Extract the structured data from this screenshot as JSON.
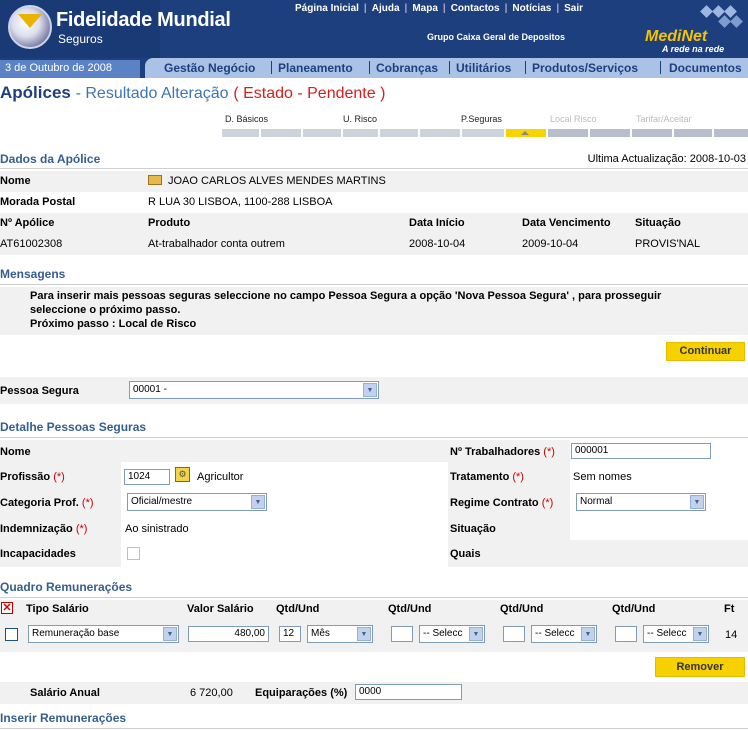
{
  "brand": {
    "name": "Fidelidade Mundial",
    "sub": "Seguros"
  },
  "top_links": [
    "Página Inicial",
    "Ajuda",
    "Mapa",
    "Contactos",
    "Notícias",
    "Sair"
  ],
  "group_text": "Grupo Caixa Geral de Depositos",
  "medinet": {
    "name": "MediNet",
    "tagline": "A rede na rede"
  },
  "date": "3 de Outubro de 2008",
  "nav": [
    "Gestão Negócio",
    "Planeamento",
    "Cobranças",
    "Utilitários",
    "Produtos/Serviços",
    "Documentos"
  ],
  "title": {
    "main": "Apólices",
    "sub": "- Resultado Alteração",
    "state": "( Estado - Pendente )"
  },
  "steps": [
    "D. Básicos",
    "U. Risco",
    "P.Seguras",
    "Local Risco",
    "Tarifar/Aceitar"
  ],
  "policy": {
    "section": "Dados da Apólice",
    "last_update": "Ultima Actualização: 2008-10-03",
    "name_label": "Nome",
    "name_value": "JOAO CARLOS ALVES MENDES MARTINS",
    "address_label": "Morada Postal",
    "address_value": "R LUA 30 LISBOA, 1100-288 LISBOA",
    "headers": [
      "Nº Apólice",
      "Produto",
      "Data Início",
      "Data Vencimento",
      "Situação"
    ],
    "row": [
      "AT61002308",
      "At-trabalhador conta outrem",
      "2008-10-04",
      "2009-10-04",
      "PROVIS'NAL"
    ]
  },
  "messages": {
    "section": "Mensagens",
    "line1": "Para inserir mais pessoas seguras seleccione no campo Pessoa Segura a opção 'Nova Pessoa Segura' , para prosseguir",
    "line2": "seleccione o próximo passo.",
    "line3": "Próximo passo : Local de Risco",
    "continue": "Continuar"
  },
  "person": {
    "label": "Pessoa Segura",
    "value": "00001 -"
  },
  "detail": {
    "section": "Detalhe Pessoas Seguras",
    "nome": "Nome",
    "workers_label": "Nº Trabalhadores",
    "workers_value": "000001",
    "profession_label": "Profissão",
    "profession_code": "1024",
    "profession_name": "Agricultor",
    "treatment_label": "Tratamento",
    "treatment_value": "Sem nomes",
    "category_label": "Categoria Prof.",
    "category_value": "Oficial/mestre",
    "regime_label": "Regime Contrato",
    "regime_value": "Normal",
    "indemn_label": "Indemnização",
    "indemn_value": "Ao sinistrado",
    "situacao_label": "Situação",
    "incap_label": "Incapacidades",
    "quais_label": "Quais",
    "req": "(*)"
  },
  "remuneracoes": {
    "section": "Quadro Remunerações",
    "headers": {
      "tipo": "Tipo Salário",
      "valor": "Valor Salário",
      "qtd": "Qtd/Und",
      "ft": "Ft"
    },
    "row": {
      "tipo": "Remuneração base",
      "valor": "480,00",
      "qtd1": "12",
      "und1": "Mês",
      "und_placeholder": "-- Selecc",
      "ft": "14"
    },
    "remove": "Remover",
    "annual_label": "Salário Anual",
    "annual_value": "6 720,00",
    "equip_label": "Equiparações (%)",
    "equip_value": "0000"
  },
  "insert_section": "Inserir Remunerações"
}
